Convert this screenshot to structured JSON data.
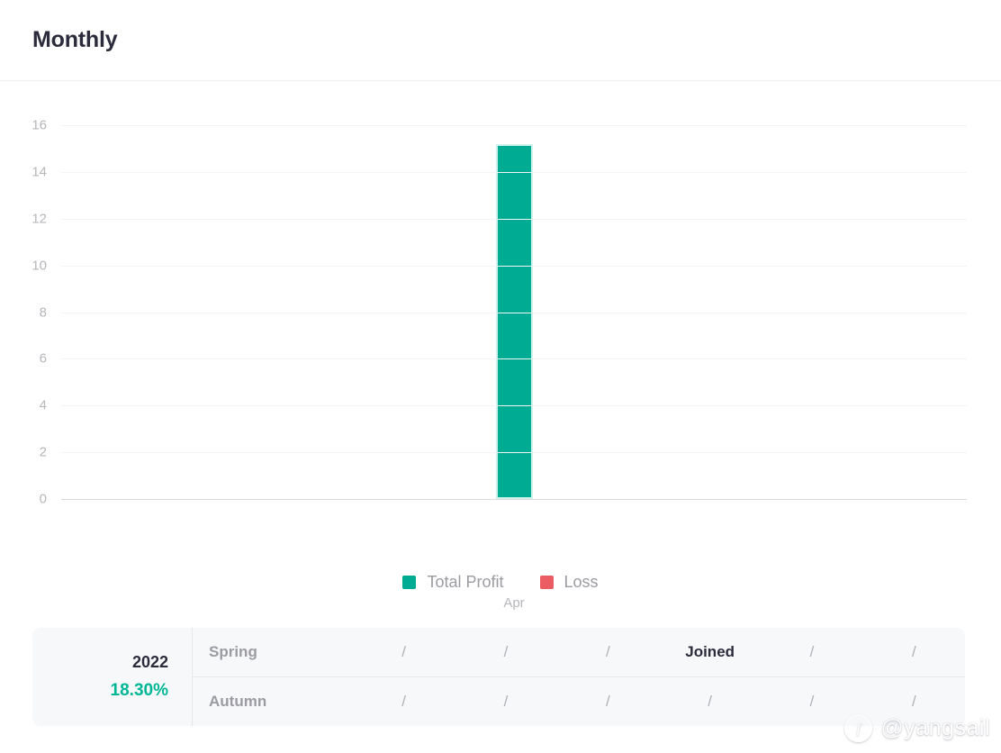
{
  "header": {
    "title": "Monthly"
  },
  "chart_data": {
    "type": "bar",
    "title": "Monthly",
    "categories": [
      "Apr"
    ],
    "series": [
      {
        "name": "Total Profit",
        "values": [
          15.2
        ],
        "color": "#00ab94"
      },
      {
        "name": "Loss",
        "values": [
          0
        ],
        "color": "#ea5c62"
      }
    ],
    "xlabel": "",
    "ylabel": "",
    "ylim": [
      0,
      16
    ],
    "yticks": [
      16,
      14,
      12,
      10,
      8,
      6,
      4,
      2,
      0
    ],
    "grid": true,
    "legend_position": "bottom"
  },
  "legend": {
    "items": [
      {
        "label": "Total Profit",
        "color": "#00ab94"
      },
      {
        "label": "Loss",
        "color": "#ea5c62"
      }
    ]
  },
  "table": {
    "year": "2022",
    "percent": "18.30%",
    "rows": [
      {
        "name": "Spring",
        "cells": [
          "/",
          "/",
          "/",
          "Joined",
          "/",
          "/"
        ]
      },
      {
        "name": "Autumn",
        "cells": [
          "/",
          "/",
          "/",
          "/",
          "/",
          "/"
        ]
      }
    ]
  },
  "watermark": {
    "handle": "@yangsail",
    "logo_glyph": "f"
  }
}
